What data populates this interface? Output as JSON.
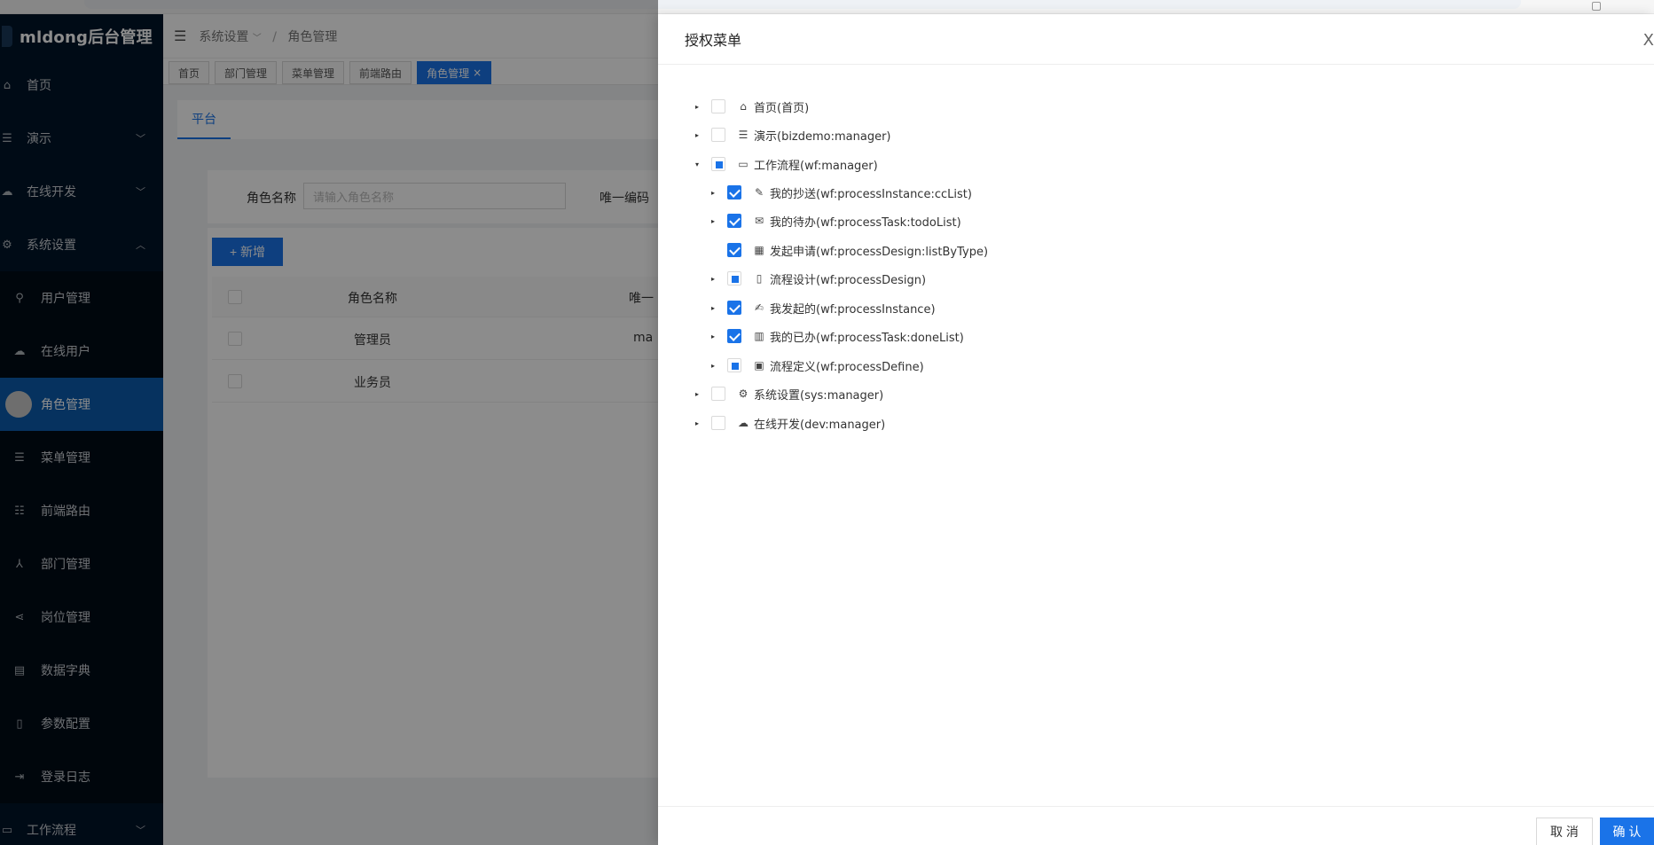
{
  "app": {
    "title": "mldong后台管理"
  },
  "sidebar": {
    "items": [
      {
        "label": "首页",
        "icon": "home-icon"
      },
      {
        "label": "演示",
        "icon": "list-icon"
      },
      {
        "label": "在线开发",
        "icon": "cloud-icon"
      },
      {
        "label": "系统设置",
        "icon": "gear-icon"
      }
    ],
    "sub_items": [
      {
        "label": "用户管理",
        "icon": "user-icon"
      },
      {
        "label": "在线用户",
        "icon": "cloud-user-icon"
      },
      {
        "label": "角色管理",
        "icon": "avatar"
      },
      {
        "label": "菜单管理",
        "icon": "menu-icon"
      },
      {
        "label": "前端路由",
        "icon": "route-icon"
      },
      {
        "label": "部门管理",
        "icon": "org-icon"
      },
      {
        "label": "岗位管理",
        "icon": "share-icon"
      },
      {
        "label": "数据字典",
        "icon": "book-icon"
      },
      {
        "label": "参数配置",
        "icon": "file-icon"
      },
      {
        "label": "登录日志",
        "icon": "login-icon"
      }
    ],
    "bottom_item": {
      "label": "工作流程",
      "icon": "laptop-icon"
    }
  },
  "breadcrumb": {
    "parent": "系统设置",
    "current": "角色管理"
  },
  "tags": [
    {
      "label": "首页"
    },
    {
      "label": "部门管理"
    },
    {
      "label": "菜单管理"
    },
    {
      "label": "前端路由"
    },
    {
      "label": "角色管理",
      "close": "×"
    }
  ],
  "platform_tab": "平台",
  "search": {
    "role_name_label": "角色名称",
    "role_name_placeholder": "请输入角色名称",
    "code_label": "唯一编码"
  },
  "add_button": "+ 新增",
  "table": {
    "headers": {
      "name": "角色名称",
      "code": "唯一"
    },
    "rows": [
      {
        "name": "管理员",
        "code": "ma"
      },
      {
        "name": "业务员",
        "code": ""
      }
    ]
  },
  "drawer": {
    "title": "授权菜单",
    "close": "X",
    "cancel": "取 消",
    "ok": "确 认",
    "tree": [
      {
        "label": "首页(首页)",
        "icon": "home-icon",
        "state": "unchecked",
        "expander": "▸"
      },
      {
        "label": "演示(bizdemo:manager)",
        "icon": "list-icon",
        "state": "unchecked",
        "expander": "▸"
      },
      {
        "label": "工作流程(wf:manager)",
        "icon": "laptop-icon",
        "state": "half",
        "expander": "▾"
      },
      {
        "label": "我的抄送(wf:processInstance:ccList)",
        "icon": "edit-icon",
        "state": "checked",
        "expander": "▸",
        "child": true
      },
      {
        "label": "我的待办(wf:processTask:todoList)",
        "icon": "mail-icon",
        "state": "checked",
        "expander": "▸",
        "child": true
      },
      {
        "label": "发起申请(wf:processDesign:listByType)",
        "icon": "grid-icon",
        "state": "checked",
        "expander": "",
        "child": true
      },
      {
        "label": "流程设计(wf:processDesign)",
        "icon": "doc-icon",
        "state": "half",
        "expander": "▸",
        "child": true
      },
      {
        "label": "我发起的(wf:processInstance)",
        "icon": "form-icon",
        "state": "checked",
        "expander": "▸",
        "child": true
      },
      {
        "label": "我的已办(wf:processTask:doneList)",
        "icon": "read-icon",
        "state": "checked",
        "expander": "▸",
        "child": true
      },
      {
        "label": "流程定义(wf:processDefine)",
        "icon": "picture-icon",
        "state": "half",
        "expander": "▸",
        "child": true
      },
      {
        "label": "系统设置(sys:manager)",
        "icon": "gear-icon",
        "state": "unchecked",
        "expander": "▸"
      },
      {
        "label": "在线开发(dev:manager)",
        "icon": "cloud-icon",
        "state": "unchecked",
        "expander": "▸"
      }
    ]
  }
}
